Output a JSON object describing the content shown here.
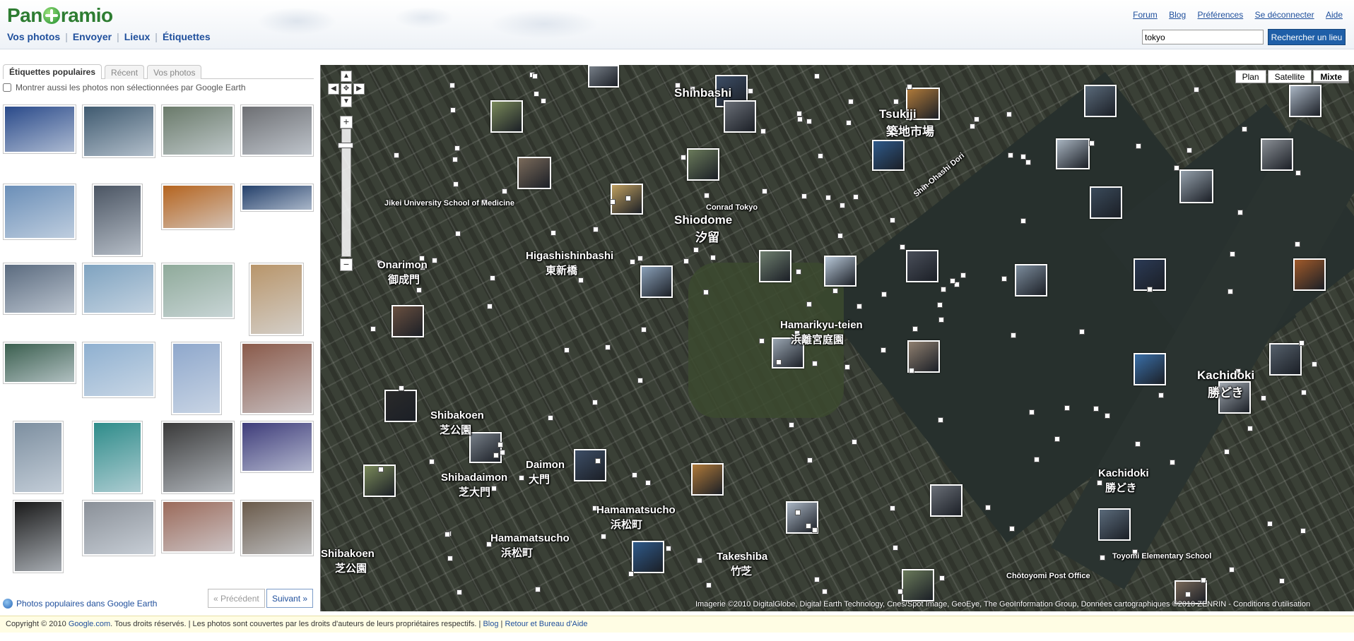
{
  "header": {
    "logo": "Panoramio",
    "nav": [
      {
        "label": "Vos photos"
      },
      {
        "label": "Envoyer"
      },
      {
        "label": "Lieux"
      },
      {
        "label": "Étiquettes"
      }
    ],
    "top_links": [
      {
        "label": "Forum"
      },
      {
        "label": "Blog"
      },
      {
        "label": "Préférences"
      },
      {
        "label": "Se déconnecter"
      },
      {
        "label": "Aide"
      }
    ],
    "search": {
      "value": "tokyo",
      "button_label": "Rechercher un lieu"
    }
  },
  "sidebar": {
    "tabs": [
      {
        "label": "Étiquettes populaires",
        "active": true
      },
      {
        "label": "Récent",
        "active": false
      },
      {
        "label": "Vos photos",
        "active": false
      }
    ],
    "filter_checkbox_label": "Montrer aussi les photos non sélectionnées par Google Earth",
    "filter_checked": false,
    "thumbnail_colors": [
      "#2a4a8a",
      "#3f5a70",
      "#6a7a6a",
      "#6d6f73",
      "#6b8fb8",
      "#4b5563",
      "#b5641f",
      "#24406b",
      "#5b6b7f",
      "#7fa3c0",
      "#8faa9a",
      "#b8956a",
      "#3b5f4f",
      "#8fb0d0",
      "#8fa8cc",
      "#8a5a4a",
      "#7d8fa0",
      "#2e8c8a",
      "#3a3a3a",
      "#3e3c7a",
      "#1a1a1a",
      "#8a9098",
      "#9b6a5a",
      "#6a5a4a"
    ],
    "ge_link": "Photos populaires dans Google Earth",
    "prev_label": "« Précédent",
    "next_label": "Suivant »"
  },
  "map": {
    "type_buttons": [
      {
        "label": "Plan",
        "active": false
      },
      {
        "label": "Satellite",
        "active": false
      },
      {
        "label": "Mixte",
        "active": true
      }
    ],
    "labels": [
      "Shinbashi",
      "Tsukiji",
      "築地市場",
      "Shiodome",
      "汐留",
      "Higashishinbashi",
      "東新橋",
      "Onarimon",
      "御成門",
      "Hamarikyu-teien",
      "浜離宮庭園",
      "Kachidoki",
      "勝どき",
      "Shibakoen",
      "芝公園",
      "Shibadaimon",
      "芝大門",
      "Daimon",
      "大門",
      "Hamamatsucho",
      "浜松町",
      "Takeshiba",
      "竹芝",
      "Kachidoki",
      "勝どき",
      "Hamamatsucho",
      "浜松町",
      "Shibakoen",
      "芝公園",
      "Shin-Ohashi Dori",
      "Conrad Tokyo",
      "Toyomi Elementary School",
      "Chōtoyomi Post Office",
      "Jikei University School of Medicine"
    ],
    "copyright": "Imagerie ©2010 DigitalGlobe, Digital Earth Technology, Cnes/Spot Image, GeoEye, The GeoInformation Group, Données cartographiques ©2010 ZENRIN - Conditions d'utilisation",
    "photo_colors": [
      "#777f88",
      "#3d4e66",
      "#b07a3a",
      "#7a8a5a",
      "#6a6f77",
      "#5a6a7a",
      "#aab6c4",
      "#2f5a8a",
      "#6a7a5a",
      "#7a6a5a",
      "#a8b4c0",
      "#3a4a5a",
      "#8a8f95",
      "#94a0ab",
      "#c0a060",
      "#6f7f6f",
      "#4a4f5a",
      "#b8c8d8",
      "#a05a2a",
      "#7c8c9c",
      "#2b3a55",
      "#5f6a76",
      "#8aa0b8",
      "#6a5040",
      "#9aa6b2",
      "#3a6fa8",
      "#55606b",
      "#a1a9b1",
      "#2a2a2a",
      "#8f7f6f"
    ]
  },
  "footer": {
    "copyright_prefix": "Copyright © 2010 ",
    "google_link": "Google.com",
    "copyright_suffix": ". Tous droits réservés.  | Les photos sont couvertes par les droits d'auteurs de leurs propriétaires respectifs.  | ",
    "blog_link": "Blog",
    "sep": " | ",
    "help_link": "Retour et Bureau d'Aide"
  }
}
